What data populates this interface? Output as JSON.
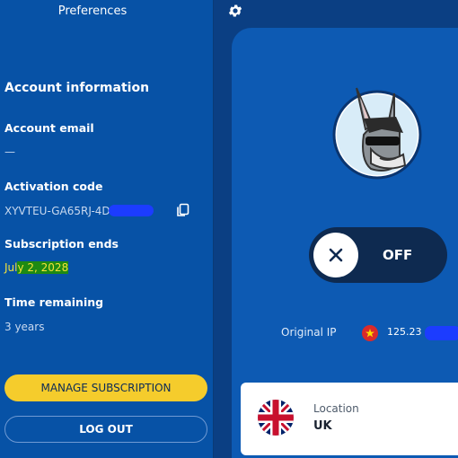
{
  "sidebar": {
    "title": "Preferences",
    "account_heading": "Account information",
    "email_label": "Account email",
    "email_value": "—",
    "activation_label": "Activation code",
    "activation_value": "XYVTEU-GA65RJ-4D",
    "subscription_label": "Subscription ends",
    "subscription_prefix": "Jul",
    "subscription_highlight": "y 2, 2028",
    "remaining_label": "Time remaining",
    "remaining_value": "3 years",
    "manage_button": "MANAGE SUBSCRIPTION",
    "logout_button": "LOG OUT"
  },
  "main": {
    "toggle_state": "OFF",
    "original_ip_label": "Original IP",
    "original_ip_value": "125.23",
    "location_label": "Location",
    "location_value": "UK"
  },
  "icons": {
    "settings": "gear-icon",
    "copy": "copy-icon",
    "close": "close-icon",
    "flag_vietnam": "flag-vietnam-icon",
    "flag_uk": "flag-uk-icon",
    "mascot": "donkey-mascot"
  },
  "colors": {
    "sidebar_bg": "#0752a6",
    "card_bg": "#0d5ab3",
    "manage_button": "#f5cc2c",
    "toggle_bg": "#0e2a50"
  }
}
